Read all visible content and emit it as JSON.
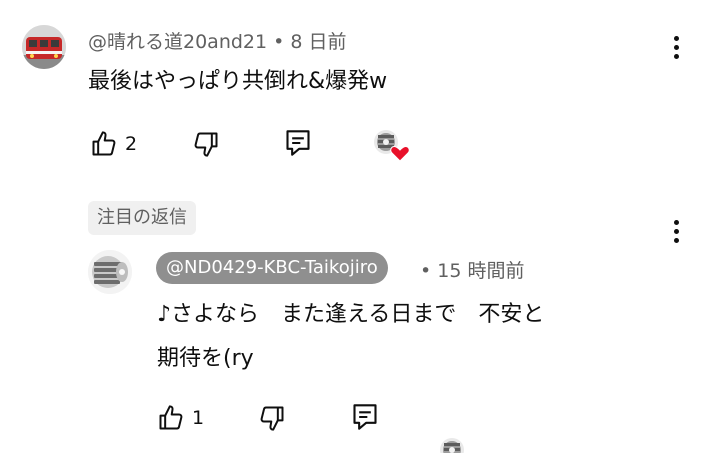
{
  "comment": {
    "author": "@晴れる道20and21",
    "time": "8 日前",
    "text": "最後はやっぱり共倒れ&爆発w",
    "likes": "2",
    "avatar_icon": "train-avatar-icon"
  },
  "reply_badge": "注目の返信",
  "reply": {
    "author": "@ND0429-KBC-Taikojiro",
    "time": "15 時間前",
    "text_lines": [
      "♪さよなら　また逢える日まで　不安と",
      "期待を(ry"
    ],
    "likes": "1",
    "avatar_icon": "gear-avatar-icon"
  },
  "separator": "•",
  "colors": {
    "text": "#0f0f0f",
    "meta": "#606060",
    "pill": "#8f8f8f",
    "heart": "#e8102a"
  },
  "icons": [
    "thumbs-up-icon",
    "thumbs-down-icon",
    "reply-icon",
    "creator-heart-icon",
    "more-options-icon"
  ]
}
